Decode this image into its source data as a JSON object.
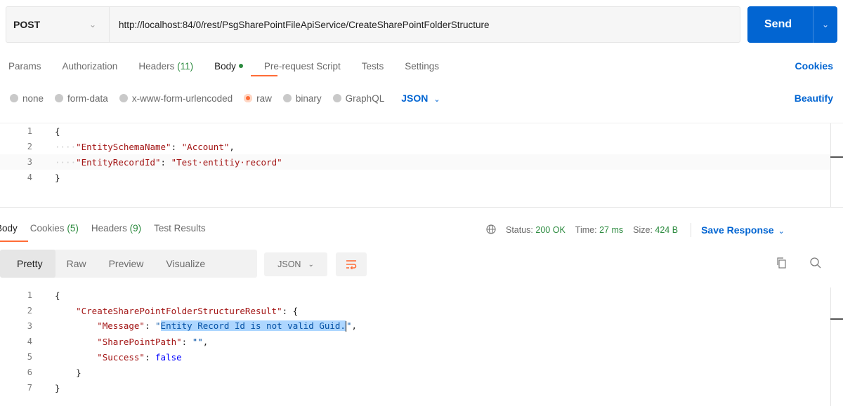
{
  "request": {
    "method": "POST",
    "url": "http://localhost:84/0/rest/PsgSharePointFileApiService/CreateSharePointFolderStructure",
    "send_label": "Send"
  },
  "request_tabs": {
    "params": "Params",
    "authorization": "Authorization",
    "headers": "Headers",
    "headers_count": "(11)",
    "body": "Body",
    "pre_request": "Pre-request Script",
    "tests": "Tests",
    "settings": "Settings",
    "cookies": "Cookies"
  },
  "body_options": {
    "none": "none",
    "form_data": "form-data",
    "urlencoded": "x-www-form-urlencoded",
    "raw": "raw",
    "binary": "binary",
    "graphql": "GraphQL",
    "format": "JSON",
    "beautify": "Beautify",
    "selected": "raw"
  },
  "request_body": {
    "line_numbers": [
      "1",
      "2",
      "3",
      "4"
    ],
    "open_brace": "{",
    "close_brace": "}",
    "indent": "····",
    "key1": "\"EntitySchemaName\"",
    "val1": "\"Account\"",
    "key2": "\"EntityRecordId\"",
    "val2": "\"Test·entitiy·record\""
  },
  "response_tabs": {
    "body": "Body",
    "cookies": "Cookies",
    "cookies_count": "(5)",
    "headers": "Headers",
    "headers_count": "(9)",
    "test_results": "Test Results"
  },
  "response_status": {
    "status_label": "Status:",
    "status_value": "200 OK",
    "time_label": "Time:",
    "time_value": "27 ms",
    "size_label": "Size:",
    "size_value": "424 B",
    "save_response": "Save Response"
  },
  "response_toolbar": {
    "pretty": "Pretty",
    "raw": "Raw",
    "preview": "Preview",
    "visualize": "Visualize",
    "format": "JSON"
  },
  "response_body": {
    "line_numbers": [
      "1",
      "2",
      "3",
      "4",
      "5",
      "6",
      "7"
    ],
    "open_brace": "{",
    "close_brace": "}",
    "result_key": "\"CreateSharePointFolderStructureResult\"",
    "message_key": "\"Message\"",
    "message_val": "Entity Record Id is not valid Guid.",
    "path_key": "\"SharePointPath\"",
    "path_val": "\"\"",
    "success_key": "\"Success\"",
    "success_val": "false"
  },
  "colors": {
    "accent": "#ff6c37",
    "primary": "#0265d2",
    "status_ok": "#2b8a3e"
  }
}
